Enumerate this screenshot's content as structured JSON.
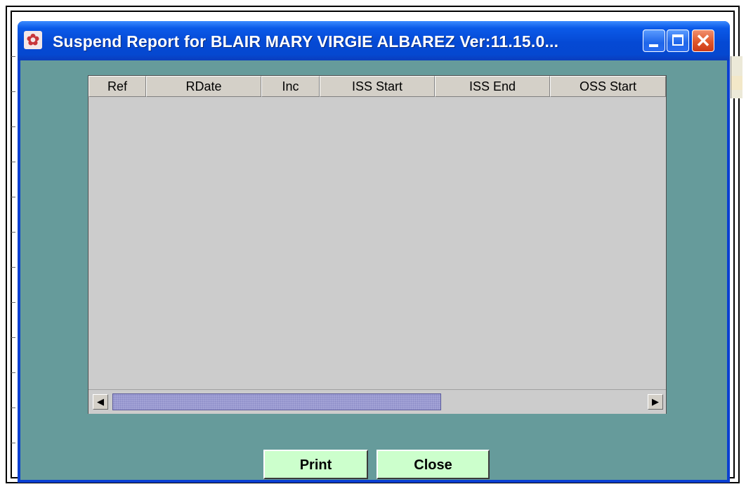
{
  "window": {
    "title": "Suspend Report for BLAIR MARY VIRGIE ALBAREZ  Ver:11.15.0...",
    "icon": "app-logo-icon",
    "controls": [
      "minimize-icon",
      "maximize-icon",
      "close-icon"
    ],
    "close_glyph": "✕"
  },
  "table": {
    "columns": [
      "Ref",
      "RDate",
      "Inc",
      "ISS Start",
      "ISS End",
      "OSS Start"
    ],
    "rows": []
  },
  "scrollbar": {
    "left_arrow": "◀",
    "right_arrow": "▶"
  },
  "buttons": {
    "print_label": "Print",
    "close_label": "Close"
  },
  "colors": {
    "titlebar": "#0549d4",
    "client_bg": "#669b9b",
    "table_bg": "#cccccc",
    "button_bg": "#ccffcc",
    "scroll_thumb": "#a3a3d6"
  }
}
